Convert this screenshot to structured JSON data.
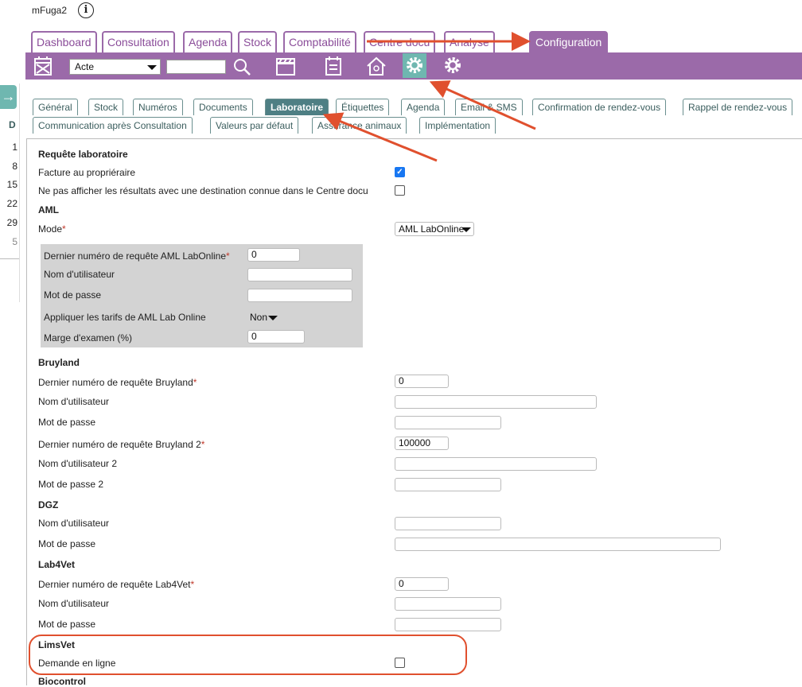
{
  "app": {
    "title": "mFuga2"
  },
  "main_tabs": [
    "Dashboard",
    "Consultation",
    "Agenda",
    "Stock",
    "Comptabilité",
    "Centre docu",
    "Analyse",
    "Configuration"
  ],
  "toolbar": {
    "select_value": "Acte",
    "search_value": ""
  },
  "left_panel": {
    "header": "D",
    "numbers": [
      "1",
      "8",
      "15",
      "22",
      "29",
      "5"
    ]
  },
  "sub_tabs_row1": [
    "Général",
    "Stock",
    "Numéros",
    "Documents",
    "Laboratoire",
    "Étiquettes",
    "Agenda",
    "Email & SMS",
    "Confirmation de rendez-vous",
    "Rappel de rendez-vous"
  ],
  "sub_tabs_row2": [
    "Communication après Consultation",
    "Valeurs par défaut",
    "Assurance animaux",
    "Implémentation"
  ],
  "form": {
    "requete": {
      "title": "Requête laboratoire",
      "facture_label": "Facture au propriéraire",
      "facture_checked": true,
      "hide_label": "Ne pas afficher les résultats avec une destination connue dans le Centre docu",
      "hide_checked": false
    },
    "aml": {
      "title": "AML",
      "mode_label": "Mode",
      "mode_value": "AML LabOnline",
      "last_num_label": "Dernier numéro de requête AML LabOnline",
      "last_num_value": "0",
      "user_label": "Nom d'utilisateur",
      "user_value": "",
      "pass_label": "Mot de passe",
      "pass_value": "",
      "tarifs_label": "Appliquer les tarifs de AML Lab Online",
      "tarifs_value": "Non",
      "marge_label": "Marge d'examen (%)",
      "marge_value": "0"
    },
    "bruyland": {
      "title": "Bruyland",
      "last_num_label": "Dernier numéro de requête Bruyland",
      "last_num_value": "0",
      "user_label": "Nom d'utilisateur",
      "pass_label": "Mot de passe",
      "last_num2_label": "Dernier numéro de requête Bruyland 2",
      "last_num2_value": "100000",
      "user2_label": "Nom d'utilisateur 2",
      "pass2_label": "Mot de passe 2"
    },
    "dgz": {
      "title": "DGZ",
      "user_label": "Nom d'utilisateur",
      "pass_label": "Mot de passe"
    },
    "lab4vet": {
      "title": "Lab4Vet",
      "last_num_label": "Dernier numéro de requête Lab4Vet",
      "last_num_value": "0",
      "user_label": "Nom d'utilisateur",
      "pass_label": "Mot de passe"
    },
    "limsvet": {
      "title": "LimsVet",
      "demande_label": "Demande en ligne",
      "demande_checked": false
    },
    "biocontrol": {
      "title": "Biocontrol"
    }
  },
  "colors": {
    "purple": "#9b6aa9",
    "teal": "#4e7f84",
    "annotation": "#e0502e"
  }
}
